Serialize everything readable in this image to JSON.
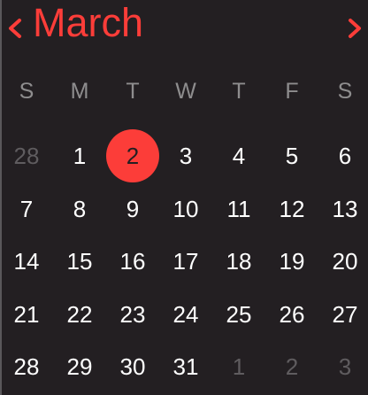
{
  "header": {
    "month": "March",
    "prev_icon": "chevron-left-icon",
    "next_icon": "chevron-right-icon"
  },
  "weekdays": [
    "S",
    "M",
    "T",
    "W",
    "T",
    "F",
    "S"
  ],
  "weeks": [
    [
      {
        "d": "28",
        "other": true
      },
      {
        "d": "1"
      },
      {
        "d": "2",
        "selected": true
      },
      {
        "d": "3"
      },
      {
        "d": "4"
      },
      {
        "d": "5"
      },
      {
        "d": "6"
      }
    ],
    [
      {
        "d": "7"
      },
      {
        "d": "8"
      },
      {
        "d": "9"
      },
      {
        "d": "10"
      },
      {
        "d": "11"
      },
      {
        "d": "12"
      },
      {
        "d": "13"
      }
    ],
    [
      {
        "d": "14"
      },
      {
        "d": "15"
      },
      {
        "d": "16"
      },
      {
        "d": "17"
      },
      {
        "d": "18"
      },
      {
        "d": "19"
      },
      {
        "d": "20"
      }
    ],
    [
      {
        "d": "21"
      },
      {
        "d": "22"
      },
      {
        "d": "23"
      },
      {
        "d": "24"
      },
      {
        "d": "25"
      },
      {
        "d": "26"
      },
      {
        "d": "27"
      }
    ],
    [
      {
        "d": "28"
      },
      {
        "d": "29"
      },
      {
        "d": "30"
      },
      {
        "d": "31"
      },
      {
        "d": "1",
        "other": true
      },
      {
        "d": "2",
        "other": true
      },
      {
        "d": "3",
        "other": true
      }
    ]
  ],
  "colors": {
    "accent": "#fc3d39",
    "background": "#231f22",
    "weekday": "#8e8d8e",
    "other_month": "#5f5c5f"
  }
}
